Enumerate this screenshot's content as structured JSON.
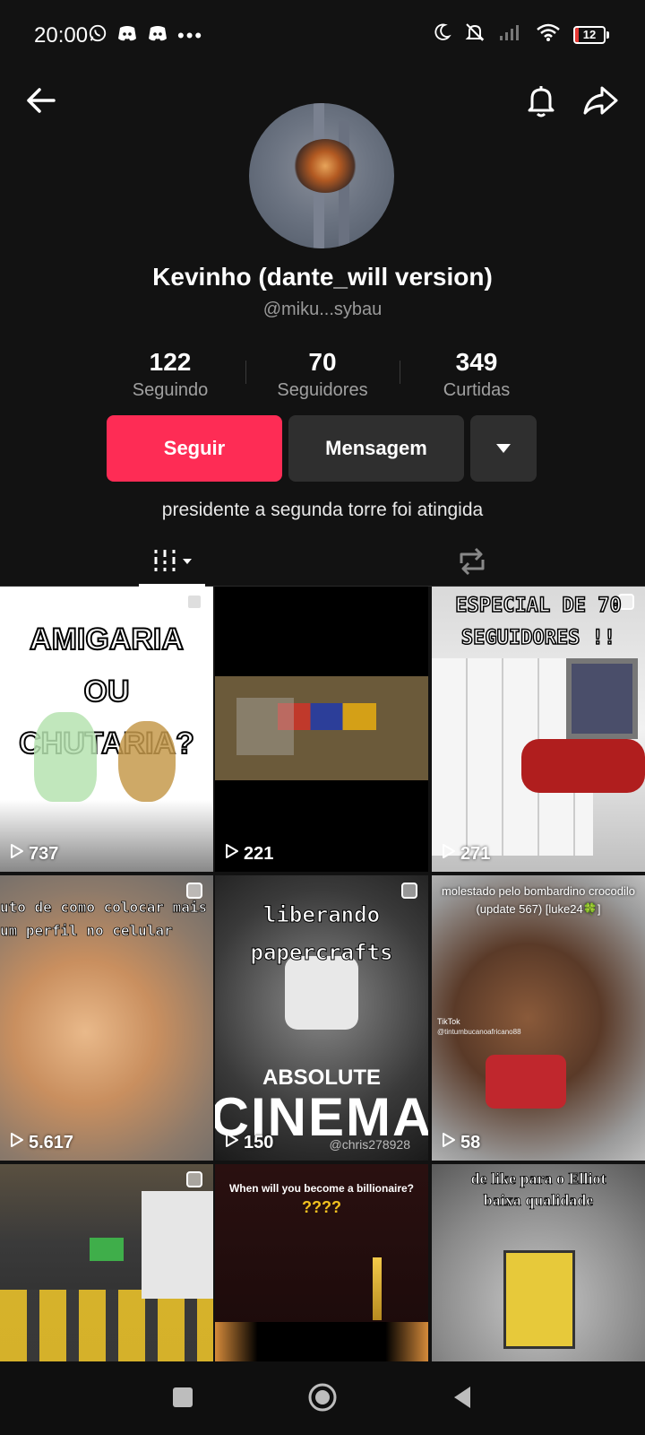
{
  "status_bar": {
    "time": "20:00",
    "battery": "12",
    "battery_level": 0.12,
    "left_icons": [
      "whatsapp-icon",
      "discord-icon",
      "discord-icon",
      "more-dots-icon"
    ],
    "right_icons": [
      "moon-icon",
      "bell-off-icon",
      "signal-icon",
      "wifi-icon",
      "battery-icon"
    ]
  },
  "profile": {
    "name": "Kevinho (dante_will version)",
    "handle": "@miku...sybau",
    "bio": "presidente a segunda torre foi atingida"
  },
  "stats": [
    {
      "value": "122",
      "label": "Seguindo"
    },
    {
      "value": "70",
      "label": "Seguidores"
    },
    {
      "value": "349",
      "label": "Curtidas"
    }
  ],
  "actions": {
    "follow": "Seguir",
    "message": "Mensagem"
  },
  "videos": [
    {
      "views": "737",
      "overlay": "AMIGARIA OU CHUTARIA?"
    },
    {
      "views": "221",
      "overlay": ""
    },
    {
      "views": "271",
      "overlay": "ESPECIAL DE 70 SEGUIDORES !!"
    },
    {
      "views": "5.617",
      "overlay_line1": "uto de como colocar mais",
      "overlay_line2": "um perfil no celular"
    },
    {
      "views": "150",
      "overlay_line1": "liberando",
      "overlay_line2": "papercrafts",
      "caption1": "ABSOLUTE",
      "caption2": "CINEMA",
      "watermark": "@chris278928"
    },
    {
      "views": "58",
      "overlay": "molestado pelo bombardino crocodilo (update 567) [luke24🍀]",
      "watermark_brand": "TikTok",
      "watermark": "@tintumbucanoafricano88"
    },
    {
      "views": "",
      "overlay": ""
    },
    {
      "views": "",
      "overlay_line1": "When will you become a billionaire?",
      "overlay_line2": "????"
    },
    {
      "views": "",
      "overlay_line1": "de like para o Elliot",
      "overlay_line2": "baixa qualidade"
    }
  ],
  "colors": {
    "accent": "#fe2c55",
    "background": "#121212",
    "secondary_button": "#2f2f2f"
  }
}
